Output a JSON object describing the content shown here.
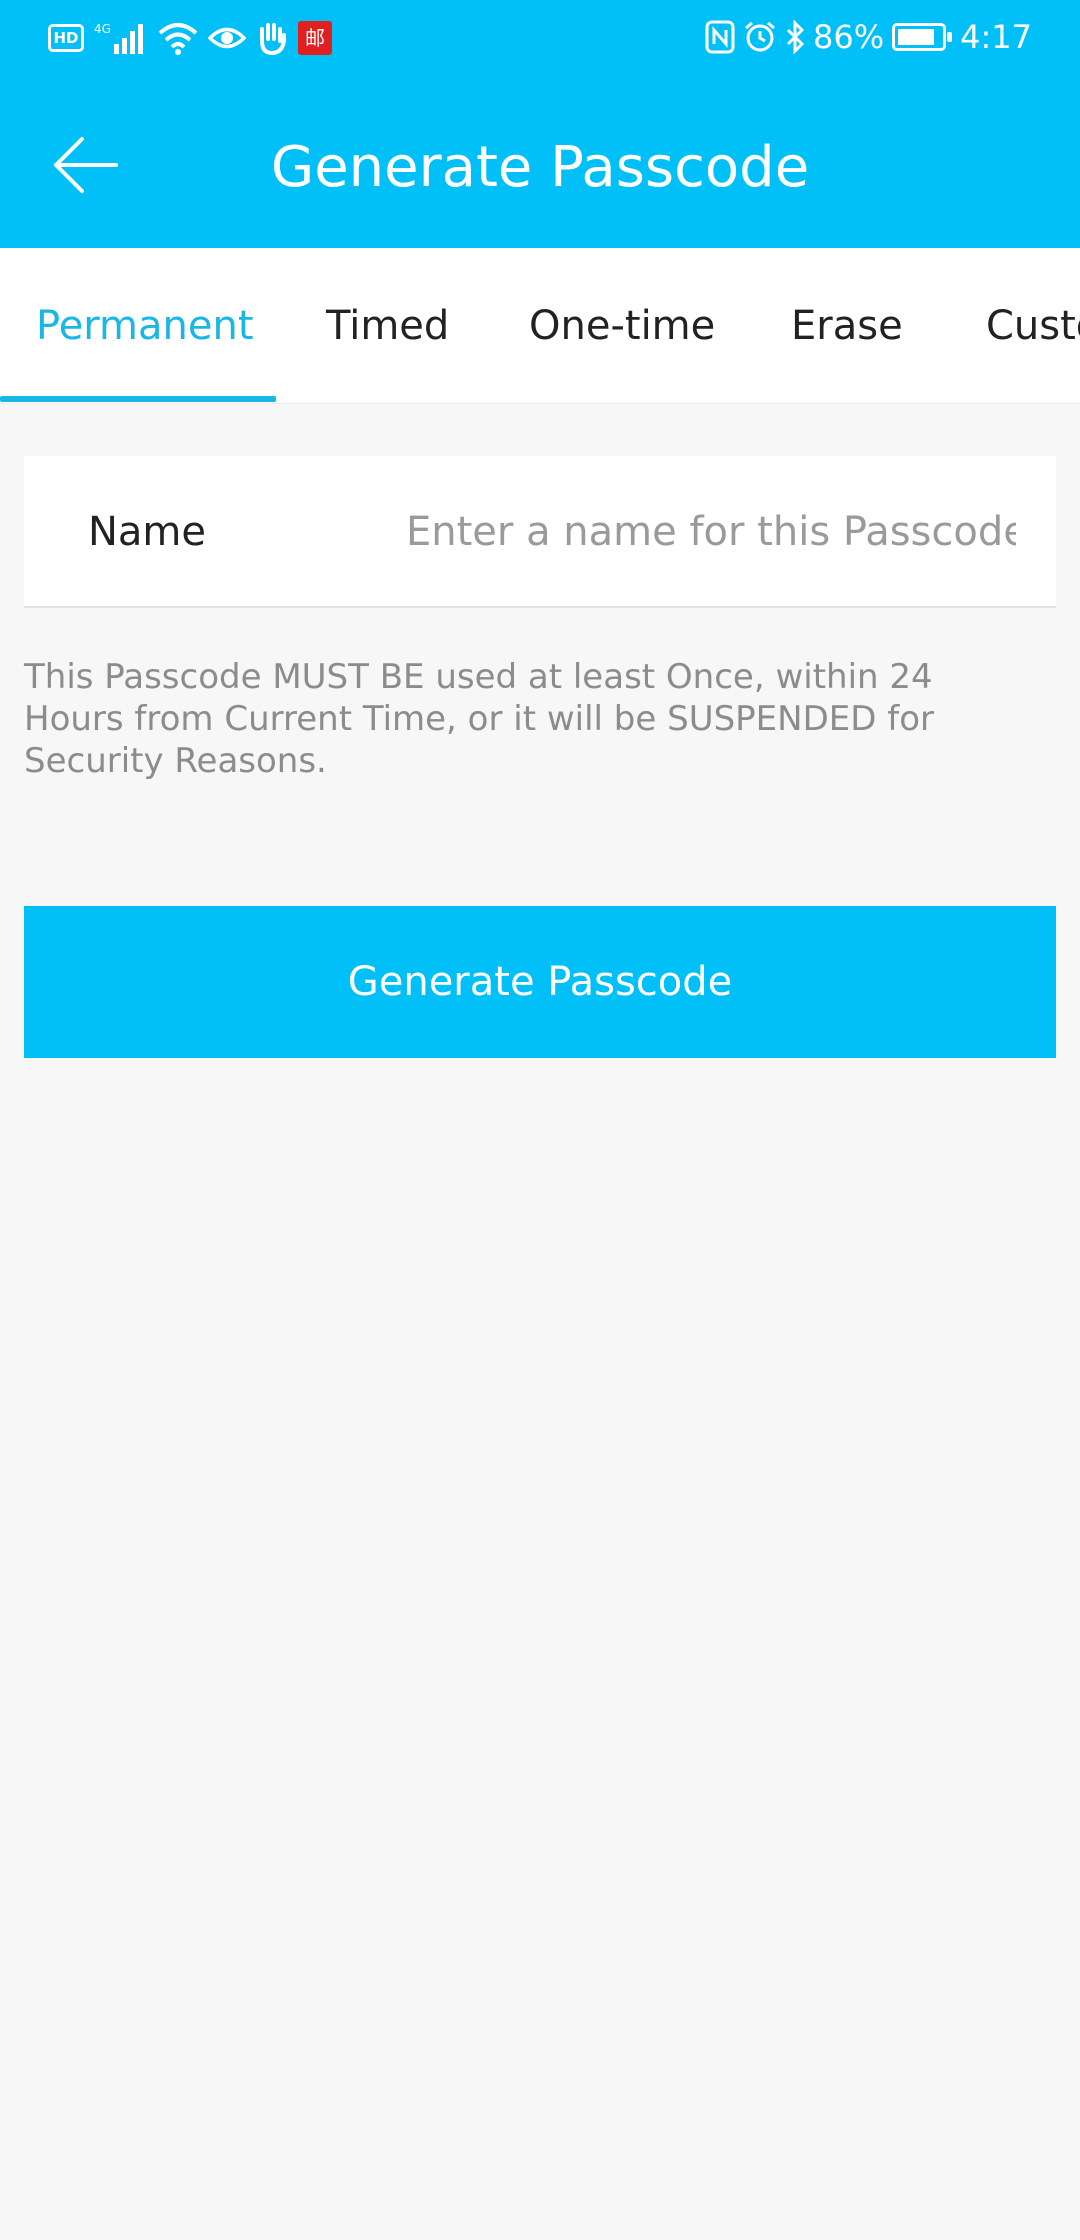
{
  "status_bar": {
    "left_icons": [
      "hd-icon",
      "cellular-4g-icon",
      "wifi-icon",
      "eye-icon",
      "hand-icon",
      "app-notification-icon"
    ],
    "hd_label": "HD",
    "signal_label": "4G",
    "app_badge": "邮",
    "right_icons": [
      "nfc-icon",
      "alarm-icon",
      "bluetooth-icon",
      "battery-icon"
    ],
    "battery": "86%",
    "battery_level": 0.86,
    "time": "4:17"
  },
  "header": {
    "title": "Generate Passcode",
    "back_icon": "arrow-left-icon"
  },
  "tabs": [
    {
      "label": "Permanent",
      "active": true
    },
    {
      "label": "Timed",
      "active": false
    },
    {
      "label": "One-time",
      "active": false
    },
    {
      "label": "Erase",
      "active": false
    },
    {
      "label": "Custom",
      "active": false
    }
  ],
  "form": {
    "name_label": "Name",
    "name_value": "",
    "name_placeholder": "Enter a name for this Passcode"
  },
  "notice": "This Passcode MUST BE used at least Once, within 24 Hours from Current Time, or it will be SUSPENDED for Security Reasons.",
  "button": {
    "label": "Generate Passcode"
  },
  "colors": {
    "primary": "#00c0f7",
    "tab_active": "#1ab6e6",
    "background": "#f7f7f7",
    "text": "#222222",
    "hint": "#8c8c8c"
  }
}
